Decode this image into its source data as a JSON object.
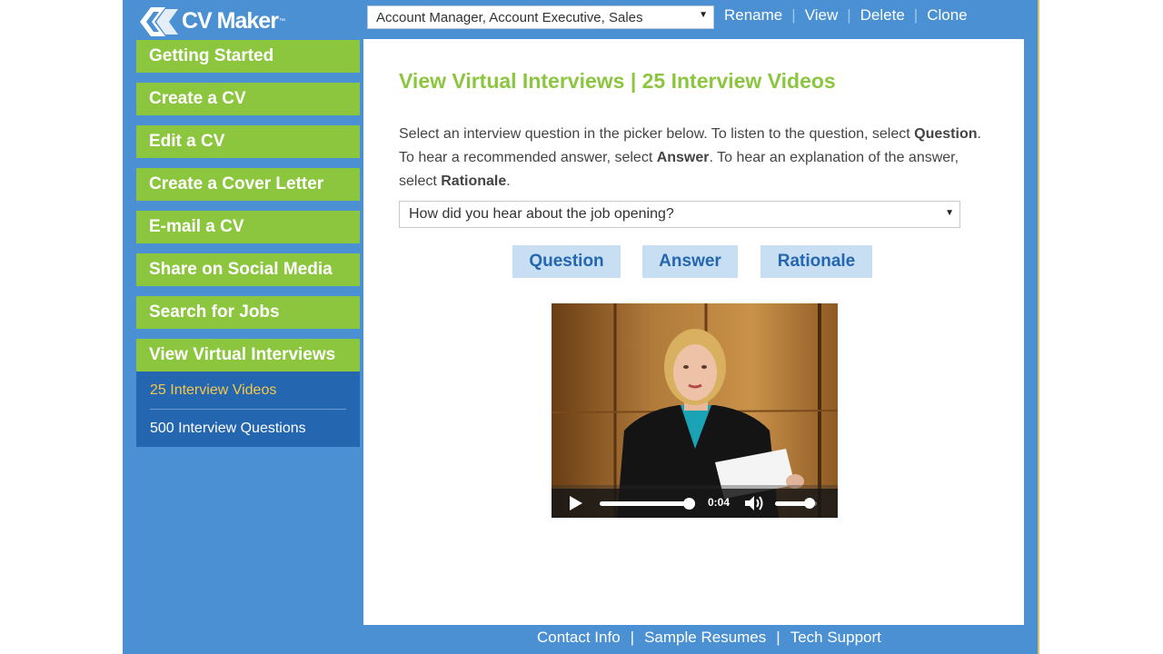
{
  "app": {
    "logo_text": "CV Maker",
    "logo_tm": "™"
  },
  "header": {
    "cv_select": {
      "value": "Account Manager, Account Executive, Sales"
    },
    "actions": [
      "Rename",
      "View",
      "Delete",
      "Clone"
    ],
    "separator": "|"
  },
  "sidebar": {
    "items": [
      {
        "label": "Getting Started"
      },
      {
        "label": "Create a CV"
      },
      {
        "label": "Edit a CV"
      },
      {
        "label": "Create a Cover Letter"
      },
      {
        "label": "E-mail a CV"
      },
      {
        "label": "Share on Social Media"
      },
      {
        "label": "Search for Jobs"
      },
      {
        "label": "View Virtual Interviews"
      }
    ],
    "subitems": [
      {
        "label": "25 Interview Videos"
      },
      {
        "label": "500 Interview Questions"
      }
    ]
  },
  "main": {
    "title": "View Virtual Interviews | 25 Interview Videos",
    "desc": {
      "p1": "Select an interview question in the picker below. To listen to the question, select ",
      "b1": "Question",
      "p2": ". To hear a recommended answer, select ",
      "b2": "Answer",
      "p3": ". To hear an explanation of the answer, select ",
      "b3": "Rationale",
      "p4": "."
    },
    "question_select": {
      "value": "How did you hear about the job opening?"
    },
    "buttons": {
      "question": "Question",
      "answer": "Answer",
      "rationale": "Rationale"
    },
    "video": {
      "time": "0:04",
      "progress": 0.94,
      "volume": 0.82
    }
  },
  "footer": {
    "links": [
      "Contact Info",
      "Sample Resumes",
      "Tech Support"
    ],
    "separator": "|"
  },
  "colors": {
    "app_blue": "#4a90d3",
    "nav_green": "#8cc63f",
    "subnav_blue": "#2566b0",
    "current_yellow": "#f4c84a",
    "button_bg": "#c7def3"
  }
}
